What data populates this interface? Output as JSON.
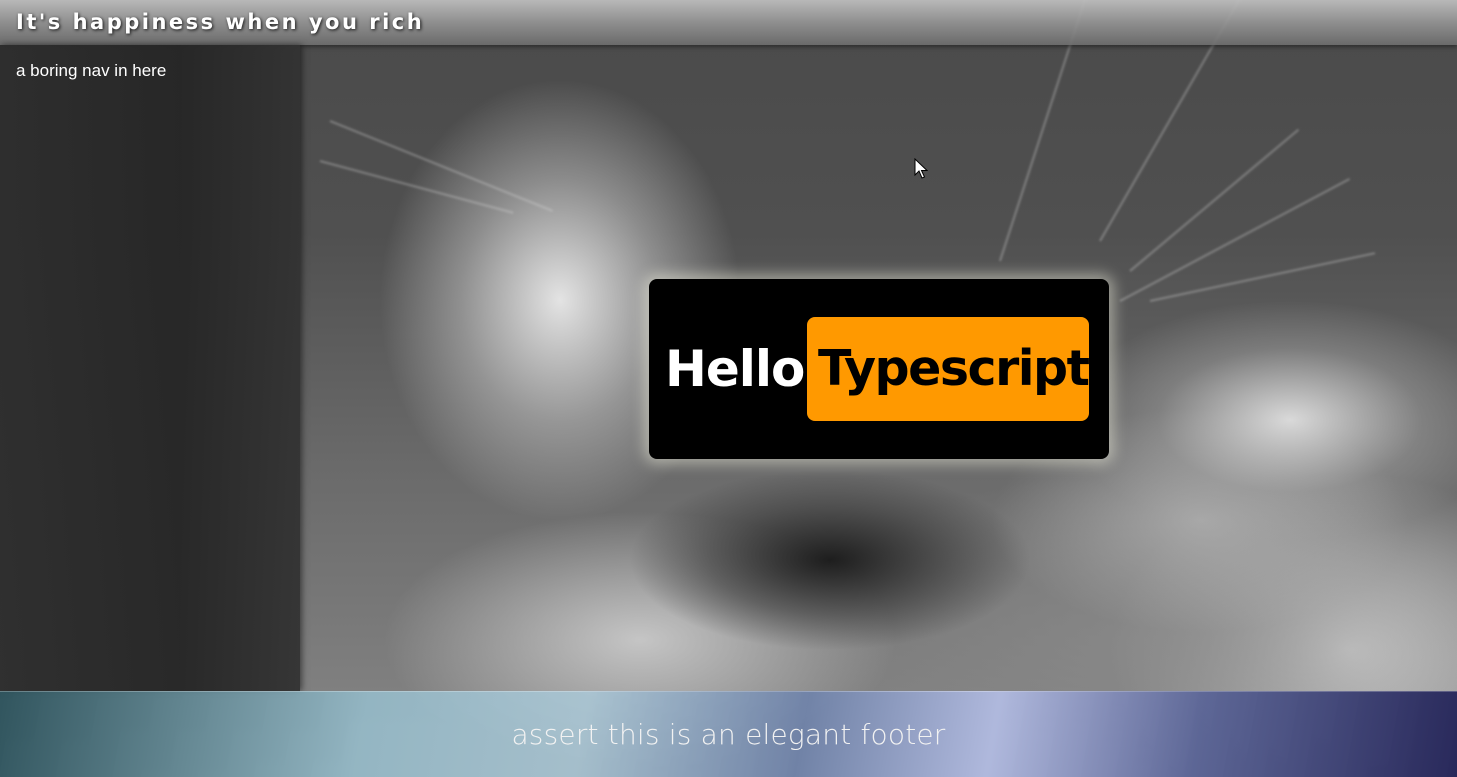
{
  "header": {
    "title": "It's happiness when you rich"
  },
  "sidebar": {
    "text": "a boring nav in here"
  },
  "main": {
    "card": {
      "hello": "Hello",
      "badge": "Typescript",
      "badge_color": "#ff9900"
    }
  },
  "footer": {
    "text": "assert this is an elegant footer"
  },
  "cursor": {
    "icon": "mouse-pointer-icon"
  }
}
